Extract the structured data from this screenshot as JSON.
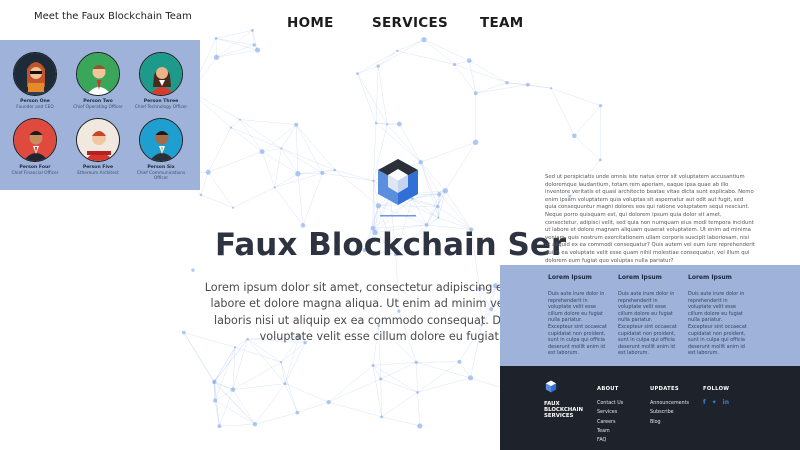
{
  "page_title": "Meet the Faux Blockchain Team",
  "nav": [
    "HOME",
    "SERVICES",
    "TEAM"
  ],
  "team": [
    {
      "name": "Person One",
      "role": "Founder and CEO",
      "bg": "#1d2a38"
    },
    {
      "name": "Person Two",
      "role": "Chief Operating Officer",
      "bg": "#3aa65a"
    },
    {
      "name": "Person Three",
      "role": "Chief Technology Officer",
      "bg": "#1e9a8a"
    },
    {
      "name": "Person Four",
      "role": "Chief Financial Officer",
      "bg": "#e0493e"
    },
    {
      "name": "Person Five",
      "role": "Ethereum Architect",
      "bg": "#f1e9df"
    },
    {
      "name": "Person Six",
      "role": "Chief Communications Officer",
      "bg": "#1e9fd0"
    }
  ],
  "hero": {
    "title": "Faux Blockchain Ser",
    "lines": [
      "Lorem ipsum dolor sit amet, consectetur adipiscing elit, sed do eiusm",
      "labore et dolore magna aliqua. Ut enim ad minim veniam, quis nost",
      "laboris nisi ut aliquip ex ea commodo consequat. Duis aute irure d",
      "voluptate velit esse cillum dolore eu fugiat nulla p"
    ]
  },
  "side_text": "Sed ut perspiciatis unde omnis iste natus error sit voluptatem accusantium doloremque laudantium, totam rem aperiam, eaque ipsa quae ab illo inventore veritatis et quasi architecto beatae vitae dicta sunt explicabo. Nemo enim ipsam voluptatem quia voluptas sit aspernatur aut odit aut fugit, sed quia consequuntur magni dolores eos qui ratione voluptatem sequi nesciunt. Neque porro quisquam est, qui dolorem ipsum quia dolor sit amet, consectetur, adipisci velit, sed quia non numquam eius modi tempora incidunt ut labore et dolore magnam aliquam quaerat voluptatem. Ut enim ad minima veniam, quis nostrum exercitationem ullam corporis suscipit laboriosam, nisi ut aliquid ex ea commodi consequatur? Quis autem vel eum iure reprehenderit qui in ea voluptate velit esse quam nihil molestiae consequatur, vel illum qui dolorem eum fugiat quo voluptas nulla pariatur?",
  "band": {
    "columns": [
      {
        "heading": "Lorem Ipsum",
        "text": "Duis aute irure dolor in reprehenderit in voluptate velit esse cillum dolore eu fugiat nulla pariatur. Excepteur sint occaecat cupidatat non proident, sunt in culpa qui officia deserunt mollit anim id est laborum."
      },
      {
        "heading": "Lorem Ipsum",
        "text": "Duis aute irure dolor in reprehenderit in voluptate velit esse cillum dolore eu fugiat nulla pariatur. Excepteur sint occaecat cupidatat non proident, sunt in culpa qui officia deserunt mollit anim id est laborum."
      },
      {
        "heading": "Lorem Ipsum",
        "text": "Duis aute irure dolor in reprehenderit in voluptate velit esse cillum dolore eu fugiat nulla pariatur. Excepteur sint occaecat cupidatat non proident, sunt in culpa qui officia deserunt mollit anim id est laborum."
      }
    ]
  },
  "footer": {
    "brand": "FAUX BLOCKCHAIN SERVICES",
    "about": {
      "heading": "ABOUT",
      "links": [
        "Contact Us",
        "Services",
        "Careers",
        "Team",
        "FAQ"
      ]
    },
    "updates": {
      "heading": "UPDATES",
      "links": [
        "Announcements",
        "Subscribe",
        "Blog"
      ]
    },
    "follow": {
      "heading": "FOLLOW",
      "icons": [
        "facebook-icon",
        "twitter-icon",
        "linkedin-icon"
      ]
    }
  },
  "colors": {
    "panel": "#9fb2d9",
    "footer": "#1e232b",
    "accent": "#3b82d6"
  }
}
